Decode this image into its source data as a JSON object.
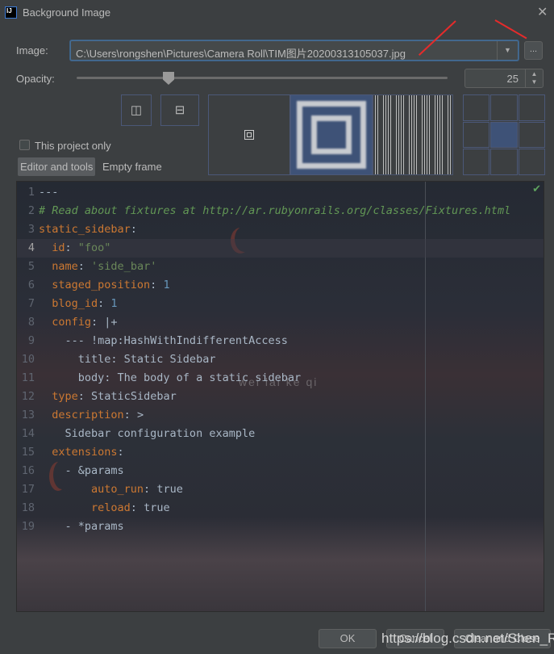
{
  "window": {
    "title": "Background Image",
    "logo_text": "IJ"
  },
  "image": {
    "label": "Image:",
    "path": "C:\\Users\\rongshen\\Pictures\\Camera Roll\\TIM图片20200313105037.jpg",
    "browse_label": "..."
  },
  "opacity": {
    "label": "Opacity:",
    "value": "25",
    "percent": 25
  },
  "options": {
    "this_project_only": "This project only",
    "checked": false,
    "tabs": [
      "Editor and tools",
      "Empty frame"
    ],
    "selected_tab": "Editor and tools"
  },
  "fill_modes": [
    "plain",
    "scale",
    "tile"
  ],
  "selected_fill": "scale",
  "anchor_selected": "center",
  "editor": {
    "lines": [
      [
        [
          "---",
          "p"
        ]
      ],
      [
        [
          "# Read about fixtures at http://ar.rubyonrails.org/classes/Fixtures.html",
          "c"
        ]
      ],
      [
        [
          "static_sidebar",
          "k"
        ],
        [
          ":",
          "p"
        ]
      ],
      [
        [
          "  id",
          "k"
        ],
        [
          ": ",
          "p"
        ],
        [
          "\"foo\"",
          "s"
        ]
      ],
      [
        [
          "  name",
          "k"
        ],
        [
          ": ",
          "p"
        ],
        [
          "'side_bar'",
          "s"
        ]
      ],
      [
        [
          "  staged_position",
          "k"
        ],
        [
          ": ",
          "p"
        ],
        [
          "1",
          "n"
        ]
      ],
      [
        [
          "  blog_id",
          "k"
        ],
        [
          ": ",
          "p"
        ],
        [
          "1",
          "n"
        ]
      ],
      [
        [
          "  config",
          "k"
        ],
        [
          ": ",
          "p"
        ],
        [
          "|+",
          "p"
        ]
      ],
      [
        [
          "    --- !map:HashWithIndifferentAccess",
          "p"
        ]
      ],
      [
        [
          "      title: Static Sidebar",
          "p"
        ]
      ],
      [
        [
          "      body: The body of a static sidebar",
          "p"
        ]
      ],
      [
        [
          "  type",
          "k"
        ],
        [
          ": ",
          "p"
        ],
        [
          "StaticSidebar",
          "p"
        ]
      ],
      [
        [
          "  description",
          "k"
        ],
        [
          ": ",
          "p"
        ],
        [
          ">",
          "p"
        ]
      ],
      [
        [
          "    Sidebar configuration example",
          "p"
        ]
      ],
      [
        [
          "  extensions",
          "k"
        ],
        [
          ":",
          "p"
        ]
      ],
      [
        [
          "    - &params",
          "p"
        ]
      ],
      [
        [
          "        auto_run",
          "k"
        ],
        [
          ": ",
          "p"
        ],
        [
          "true",
          "p"
        ]
      ],
      [
        [
          "        reload",
          "k"
        ],
        [
          ": ",
          "p"
        ],
        [
          "true",
          "p"
        ]
      ],
      [
        [
          "    - *params",
          "p"
        ]
      ]
    ],
    "current_line": 4,
    "bg_text": "wei lai ke qi"
  },
  "buttons": {
    "ok": "OK",
    "cancel": "Cancel",
    "clear": "Clear and Close"
  },
  "watermark": "https://blog.csdn.net/Shen_R",
  "colors": {
    "accent": "#4b6eaf",
    "annotation_arrow": "#e52b2b"
  }
}
